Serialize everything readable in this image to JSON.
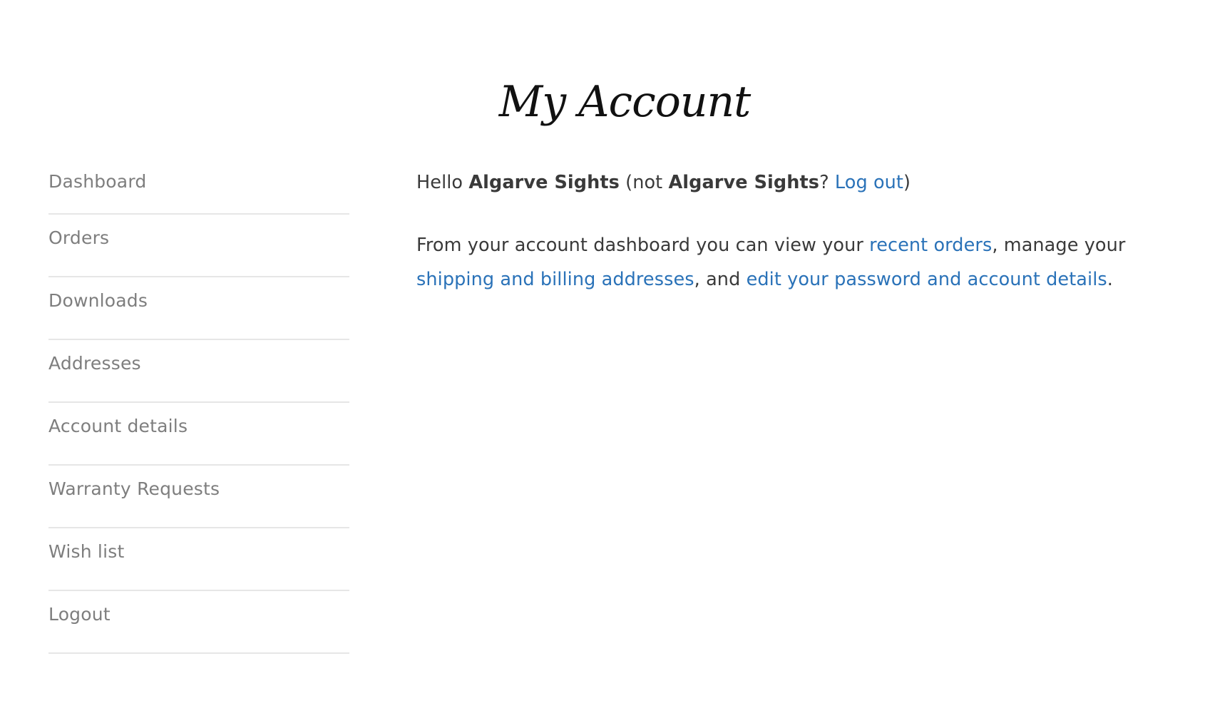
{
  "page": {
    "title": "My Account"
  },
  "nav": {
    "items": [
      {
        "label": "Dashboard"
      },
      {
        "label": "Orders"
      },
      {
        "label": "Downloads"
      },
      {
        "label": "Addresses"
      },
      {
        "label": "Account details"
      },
      {
        "label": "Warranty Requests"
      },
      {
        "label": "Wish list"
      },
      {
        "label": "Logout"
      }
    ]
  },
  "dashboard": {
    "greeting": {
      "hello": "Hello ",
      "username": "Algarve Sights",
      "not_prefix": " (not ",
      "username_again": "Algarve Sights",
      "question": "? ",
      "logout_link": "Log out",
      "close_paren": ")"
    },
    "intro": {
      "text1": "From your account dashboard you can view your ",
      "link_orders": "recent orders",
      "text2": ", manage your ",
      "link_addresses": "shipping and billing addresses",
      "text3": ", and ",
      "link_account": "edit your password and account details",
      "text4": "."
    }
  },
  "colors": {
    "link": "#2a72b8",
    "nav_text": "#7e7e7e",
    "body_text": "#3a3a3a",
    "divider": "#e6e6e6"
  }
}
